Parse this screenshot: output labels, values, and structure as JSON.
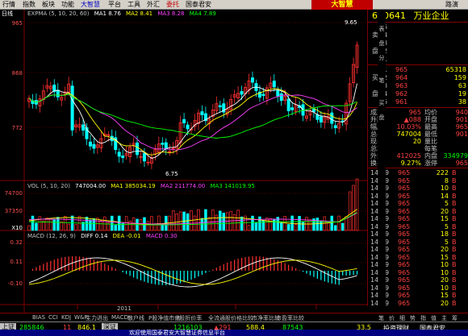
{
  "menu": {
    "items": [
      "行情",
      "指数",
      "板块",
      "功能",
      "大智慧",
      "平台",
      "工具",
      "外汇",
      "委托",
      "国泰君安"
    ],
    "brand": "大智慧",
    "route": "路演"
  },
  "chart": {
    "period": "日线",
    "ma_legend": [
      {
        "text": "EXPMA (5, 10, 20, 60)",
        "color": "#c0c0c0"
      },
      {
        "text": "MA1 8.76",
        "color": "#ffffff"
      },
      {
        "text": "MA2 8.41",
        "color": "#ffff00"
      },
      {
        "text": "MA3 8.28",
        "color": "#ff40ff"
      },
      {
        "text": "MA4 7.89",
        "color": "#00ff00"
      }
    ],
    "price_labels": [
      "965",
      "868",
      "772"
    ],
    "hi_label": "9.65",
    "lo_label": "6.75",
    "vol_legend": [
      {
        "text": "VOL (5, 10, 20)",
        "color": "#c0c0c0"
      },
      {
        "text": "747004.00",
        "color": "#ffffff"
      },
      {
        "text": "MA1 385034.19",
        "color": "#ffff00"
      },
      {
        "text": "MA2 211774.00",
        "color": "#ff40ff"
      },
      {
        "text": "MA3 141019.95",
        "color": "#00ff00"
      }
    ],
    "vol_labels": [
      "74700",
      "37350",
      "X10"
    ],
    "macd_legend": [
      {
        "text": "MACD (12, 26, 9)",
        "color": "#c0c0c0"
      },
      {
        "text": "DIFF 0.14",
        "color": "#ffffff"
      },
      {
        "text": "DEA -0.01",
        "color": "#ffff00"
      },
      {
        "text": "MACD 0.30",
        "color": "#ff40ff"
      }
    ],
    "macd_labels": [
      "0.32",
      "0.11",
      "-0.10"
    ],
    "year_label": "2011",
    "month_labels": [
      "2",
      "3",
      "4",
      "5"
    ],
    "colors": {
      "up": "#ff3030",
      "down": "#00ffff",
      "axis": "#800000",
      "grid": "#500000"
    }
  },
  "side_tabs": [
    "表",
    "盘",
    "分",
    "笔",
    "买",
    "盘"
  ],
  "stock": {
    "code": "600641",
    "name": "万业企业"
  },
  "order_book": {
    "sell": [
      {
        "side": "",
        "level": "5",
        "price": "",
        "vol": ""
      },
      {
        "side": "卖",
        "level": "4",
        "price": "",
        "vol": ""
      },
      {
        "side": "",
        "level": "3",
        "price": "",
        "vol": ""
      },
      {
        "side": "盘",
        "level": "2",
        "price": "",
        "vol": ""
      },
      {
        "side": "",
        "level": "1",
        "price": "",
        "vol": ""
      }
    ],
    "buy": [
      {
        "side": "",
        "level": "1",
        "price": "965",
        "vol": "65318"
      },
      {
        "side": "买",
        "level": "2",
        "price": "964",
        "vol": "159"
      },
      {
        "side": "",
        "level": "3",
        "price": "963",
        "vol": "63"
      },
      {
        "side": "盘",
        "level": "4",
        "price": "962",
        "vol": "19"
      },
      {
        "side": "",
        "level": "5",
        "price": "961",
        "vol": "38"
      }
    ]
  },
  "stats": [
    {
      "l1": "成交",
      "v1": "965",
      "c1": "red",
      "l2": "均价",
      "v2": "940",
      "c2": "red"
    },
    {
      "l1": "升跌",
      "v1": "▲088",
      "c1": "red",
      "l2": "开盘",
      "v2": "901",
      "c2": "red"
    },
    {
      "l1": "幅度",
      "v1": "10.03%",
      "c1": "red",
      "l2": "最高",
      "v2": "965",
      "c2": "red"
    },
    {
      "l1": "总手",
      "v1": "747004",
      "c1": "yellow",
      "l2": "最低",
      "v2": "901",
      "c2": "red"
    },
    {
      "l1": "现手",
      "v1": "20",
      "c1": "yellow",
      "l2": "量比",
      "v2": "",
      "c2": "red"
    },
    {
      "l1": "总笔",
      "v1": "",
      "c1": "yellow",
      "l2": "每笔",
      "v2": "",
      "c2": "yellow"
    },
    {
      "l1": "外盘",
      "v1": "412025",
      "c1": "red",
      "l2": "内盘",
      "v2": "334979",
      "c2": "green"
    },
    {
      "l1": "换手",
      "v1": "9.27%",
      "c1": "yellow",
      "l2": "涨停",
      "v2": "965",
      "c2": "red"
    }
  ],
  "ticks": [
    {
      "time": "14:59",
      "price": "965",
      "vol": "222",
      "flag": "B"
    },
    {
      "time": "14:59",
      "price": "965",
      "vol": "8",
      "flag": "B"
    },
    {
      "time": "14:59",
      "price": "965",
      "vol": "10",
      "flag": "B"
    },
    {
      "time": "14:59",
      "price": "965",
      "vol": "14",
      "flag": "B"
    },
    {
      "time": "14:59",
      "price": "965",
      "vol": "5",
      "flag": "B"
    },
    {
      "time": "14:59",
      "price": "965",
      "vol": "20",
      "flag": "B"
    },
    {
      "time": "14:59",
      "price": "965",
      "vol": "15",
      "flag": "B"
    },
    {
      "time": "14:59",
      "price": "965",
      "vol": "5",
      "flag": "B"
    },
    {
      "time": "14:59",
      "price": "965",
      "vol": "18",
      "flag": "B"
    },
    {
      "time": "14:59",
      "price": "965",
      "vol": "5",
      "flag": "B"
    },
    {
      "time": "14:59",
      "price": "965",
      "vol": "20",
      "flag": "B"
    },
    {
      "time": "14:59",
      "price": "965",
      "vol": "15",
      "flag": "B"
    },
    {
      "time": "14:59",
      "price": "965",
      "vol": "10",
      "flag": "B"
    },
    {
      "time": "14:59",
      "price": "965",
      "vol": "10",
      "flag": "B"
    },
    {
      "time": "14:59",
      "price": "965",
      "vol": "20",
      "flag": "B"
    },
    {
      "time": "14:59",
      "price": "965",
      "vol": "10",
      "flag": "B"
    },
    {
      "time": "14:59",
      "price": "965",
      "vol": "15",
      "flag": "B"
    },
    {
      "time": "14:59",
      "price": "965",
      "vol": "20",
      "flag": "B"
    }
  ],
  "indicator_tabs": [
    "BIAS",
    "CCI",
    "KDJ",
    "W&R",
    "主力进出",
    "MACD",
    "散户线",
    "P股净值市值",
    "P股折价率",
    "全流通股价格比较",
    "市净率比较",
    "市盈率比较"
  ],
  "right_tabs": [
    "笔",
    "价",
    "细",
    "势",
    "指",
    "值",
    "主",
    "筹"
  ],
  "status": {
    "index_name": "上证",
    "index_val": "285846",
    "v2": "11",
    "v3": "846.1",
    "sz_label": "深证",
    "v4": "1216103",
    "v5": "▲291",
    "v6": "588.4",
    "v7": "87543",
    "v8": "33.5",
    "v9": "投资理财",
    "v10": "国泰君安",
    "ticker": "欢迎使用国泰君安大智慧证券信息平台"
  }
}
